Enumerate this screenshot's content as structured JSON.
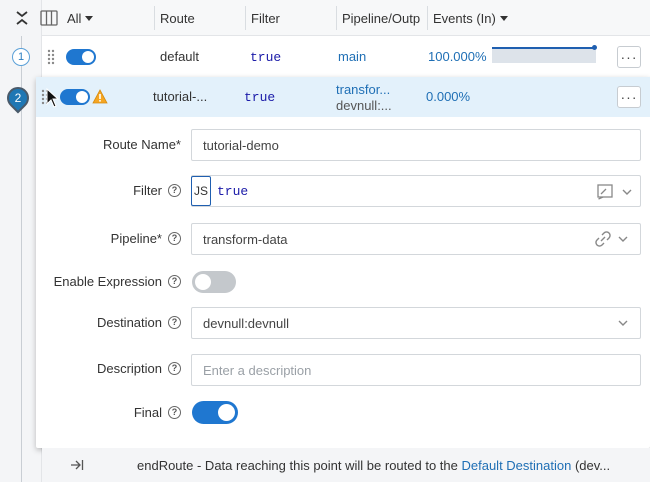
{
  "header": {
    "all_label": "All",
    "route_label": "Route",
    "filter_label": "Filter",
    "pipeline_label": "Pipeline/Outp",
    "events_label": "Events (In)"
  },
  "routes": [
    {
      "number": "1",
      "name": "default",
      "filter": "true",
      "pipeline": "main",
      "events": "100.000%",
      "enabled": true
    },
    {
      "number": "2",
      "name": "tutorial-...",
      "filter": "true",
      "pipeline_line1": "transfor...",
      "pipeline_line2": "devnull:...",
      "events": "0.000%",
      "enabled": true,
      "warning": true
    }
  ],
  "form": {
    "route_name_label": "Route Name*",
    "route_name_value": "tutorial-demo",
    "filter_label": "Filter",
    "filter_prefix": "JS",
    "filter_value": "true",
    "pipeline_label": "Pipeline*",
    "pipeline_value": "transform-data",
    "enable_expression_label": "Enable Expression",
    "destination_label": "Destination",
    "destination_value": "devnull:devnull",
    "description_label": "Description",
    "description_placeholder": "Enter a description",
    "final_label": "Final"
  },
  "end_route": {
    "text": "endRoute - Data reaching this point will be routed to the ",
    "link": "Default Destination",
    "suffix": " (dev..."
  },
  "colors": {
    "accent": "#1f77d0",
    "selected_row": "#e3f1fb",
    "warning": "#f5a623",
    "link": "#1f6fb5"
  }
}
